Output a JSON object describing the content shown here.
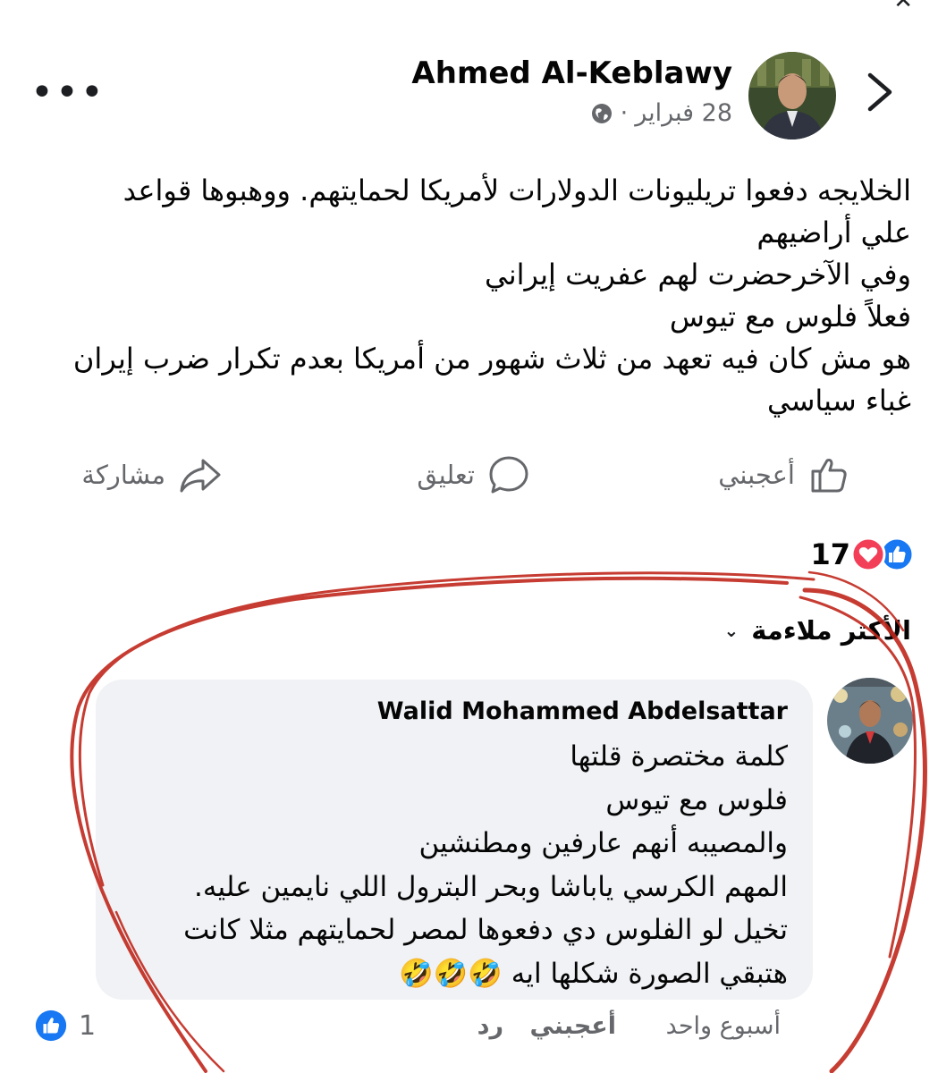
{
  "post": {
    "author": "Ahmed Al-Keblawy",
    "date": "28 فبراير",
    "separator": "·",
    "audience_icon": "globe-icon",
    "body_lines": [
      "الخلايجه دفعوا تريليونات الدولارات لأمريكا لحمايتهم. ووهبوها قواعد",
      "علي أراضيهم",
      "وفي الآخرحضرت لهم عفريت إيراني",
      "فعلاً فلوس مع تيوس",
      "هو مش كان فيه تعهد من ثلاث شهور من أمريكا بعدم تكرار ضرب إيران",
      "غباء سياسي"
    ]
  },
  "actions": {
    "like": "أعجبني",
    "comment": "تعليق",
    "share": "مشاركة"
  },
  "reactions": {
    "count": "17",
    "types": [
      "like-icon",
      "love-icon"
    ]
  },
  "comments_header": {
    "sort_label": "الأكثر ملاءمة"
  },
  "comment": {
    "author": "Walid Mohammed Abdelsattar",
    "lines": [
      "كلمة مختصرة قلتها",
      "فلوس مع تيوس",
      "والمصيبه أنهم عارفين ومطنشين",
      "المهم الكرسي ياباشا وبحر البترول اللي نايمين عليه.",
      "تخيل لو الفلوس دي دفعوها لمصر لحمايتهم مثلا كانت",
      "هتبقي الصورة شكلها ايه 🤣🤣🤣"
    ],
    "time": "أسبوع واحد",
    "like_label": "أعجبني",
    "reply_label": "رد",
    "reaction_count": "1"
  },
  "colors": {
    "brand_blue": "#1877f2",
    "love_red": "#f33e58",
    "annotation_red": "#c0281c",
    "secondary_text": "#65676b",
    "bubble_bg": "#f0f2f5"
  }
}
